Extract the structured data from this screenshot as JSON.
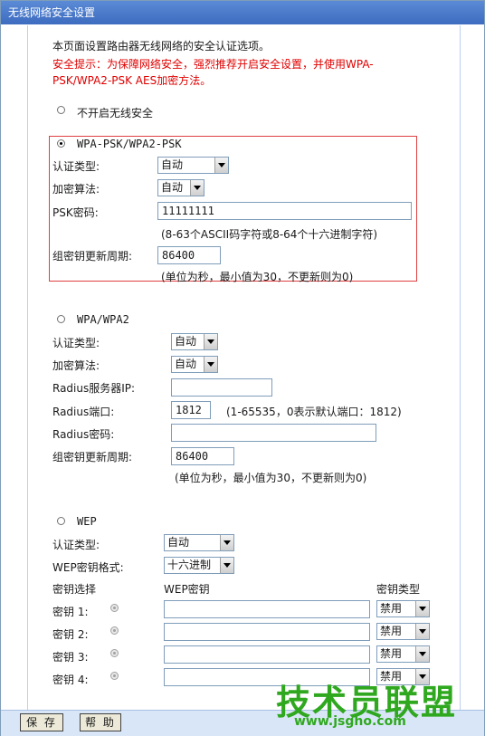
{
  "title": "无线网络安全设置",
  "intro": "本页面设置路由器无线网络的安全认证选项。",
  "warning_line1": "安全提示：为保障网络安全，强烈推荐开启安全设置，并使用WPA-",
  "warning_line2": "PSK/WPA2-PSK AES加密方法。",
  "no_security_label": "不开启无线安全",
  "psk": {
    "label": "WPA-PSK/WPA2-PSK",
    "auth_type_label": "认证类型:",
    "auth_type_value": "自动",
    "encryption_label": "加密算法:",
    "encryption_value": "自动",
    "password_label": "PSK密码:",
    "password_value": "11111111",
    "password_hint": "(8-63个ASCII码字符或8-64个十六进制字符)",
    "renewal_label": "组密钥更新周期:",
    "renewal_value": "86400",
    "renewal_hint": "(单位为秒，最小值为30，不更新则为0)"
  },
  "wpa": {
    "label": "WPA/WPA2",
    "auth_type_label": "认证类型:",
    "auth_type_value": "自动",
    "encryption_label": "加密算法:",
    "encryption_value": "自动",
    "radius_ip_label": "Radius服务器IP:",
    "radius_ip_value": "",
    "radius_port_label": "Radius端口:",
    "radius_port_value": "1812",
    "radius_port_hint": "(1-65535，0表示默认端口：1812)",
    "radius_password_label": "Radius密码:",
    "radius_password_value": "",
    "renewal_label": "组密钥更新周期:",
    "renewal_value": "86400",
    "renewal_hint": "(单位为秒，最小值为30，不更新则为0)"
  },
  "wep": {
    "label": "WEP",
    "auth_type_label": "认证类型:",
    "auth_type_value": "自动",
    "format_label": "WEP密钥格式:",
    "format_value": "十六进制",
    "key_select_header": "密钥选择",
    "key_header": "WEP密钥",
    "key_type_header": "密钥类型",
    "keys": [
      {
        "label": "密钥 1:",
        "value": "",
        "type": "禁用"
      },
      {
        "label": "密钥 2:",
        "value": "",
        "type": "禁用"
      },
      {
        "label": "密钥 3:",
        "value": "",
        "type": "禁用"
      },
      {
        "label": "密钥 4:",
        "value": "",
        "type": "禁用"
      }
    ]
  },
  "buttons": {
    "save": "保 存",
    "help": "帮 助"
  },
  "watermark": {
    "name": "技术员联盟",
    "url": "www.jsgho.com"
  },
  "colors": {
    "title_bar": "#4a7bcc",
    "warning": "#e00000",
    "highlight_border": "#e04040",
    "watermark": "#2fa81f"
  }
}
